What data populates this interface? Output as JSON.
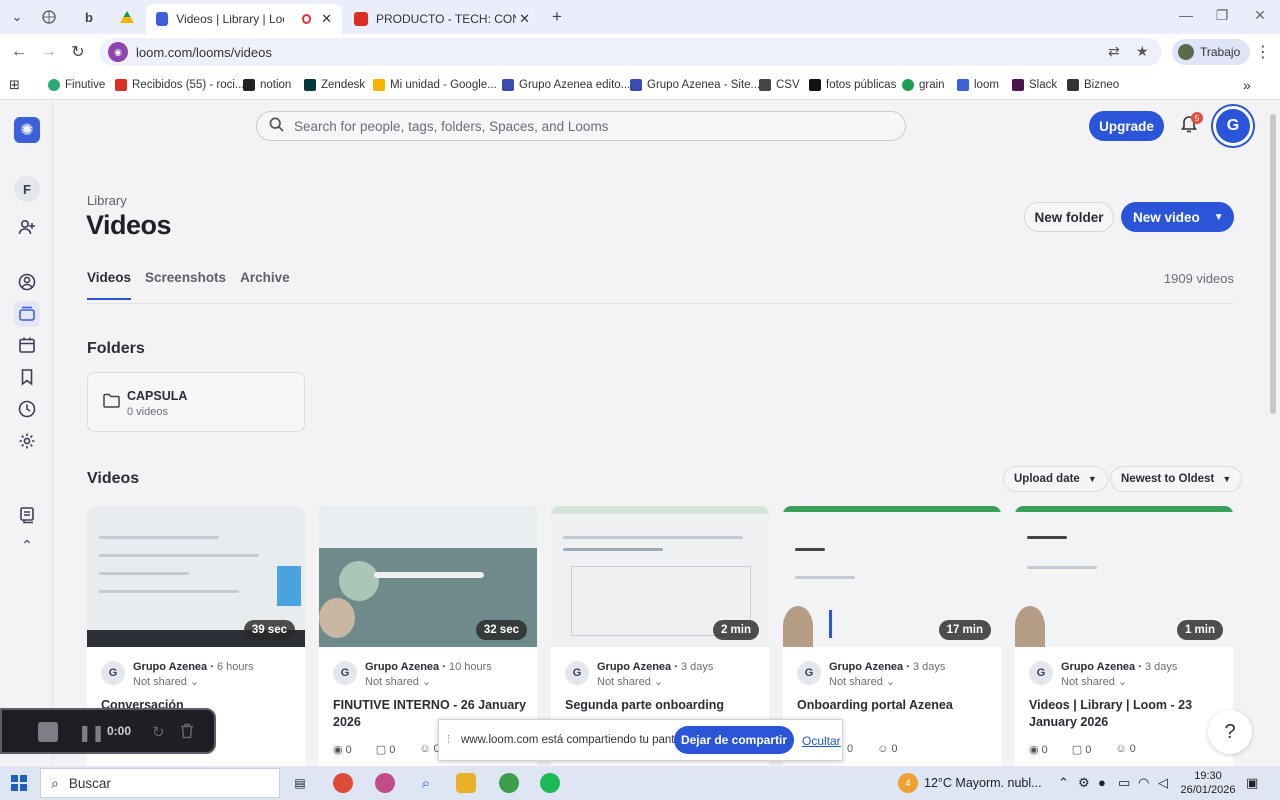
{
  "browser": {
    "tabs": [
      {
        "title": "Videos | Library | Loom",
        "active": true
      },
      {
        "title": "PRODUCTO - TECH: CONTABLE",
        "active": false
      }
    ],
    "new_tab": "+",
    "url": "loom.com/looms/videos",
    "profile_label": "Trabajo",
    "bookmarks": [
      "Finutive",
      "Recibidos (55) - roci...",
      "notion",
      "Zendesk",
      "Mi unidad - Google...",
      "Grupo Azenea edito...",
      "Grupo Azenea - Site...",
      "CSV",
      "fotos públicas",
      "grain",
      "loom",
      "Slack",
      "Bizneo"
    ],
    "bookmarks_more": "»"
  },
  "sidebar": {
    "workspace_initial": "F",
    "icons": [
      "invite-icon",
      "profile-icon",
      "library-icon",
      "calendar-icon",
      "bookmark-icon",
      "history-icon",
      "settings-icon",
      "notes-icon"
    ]
  },
  "header": {
    "search_placeholder": "Search for people, tags, folders, Spaces, and Looms",
    "upgrade_label": "Upgrade",
    "notification_count": "5",
    "user_initial": "G"
  },
  "library": {
    "breadcrumb": "Library",
    "title": "Videos",
    "new_folder_label": "New folder",
    "new_video_label": "New video",
    "tabs": [
      "Videos",
      "Screenshots",
      "Archive"
    ],
    "video_count": "1909 videos",
    "folders_heading": "Folders",
    "folder": {
      "name": "CAPSULA",
      "count": "0 videos"
    },
    "videos_heading": "Videos",
    "sort_by": "Upload date",
    "sort_order": "Newest to Oldest"
  },
  "videos": [
    {
      "duration": "39 sec",
      "owner": "Grupo Azenea",
      "ago": "6 hours",
      "share": "Not shared",
      "title": "Conversación",
      "views": "0",
      "comments": "0",
      "reactions": "0"
    },
    {
      "duration": "32 sec",
      "owner": "Grupo Azenea",
      "ago": "10 hours",
      "share": "Not shared",
      "title": "FINUTIVE INTERNO - 26 January 2026",
      "views": "0",
      "comments": "0",
      "reactions": "0"
    },
    {
      "duration": "2 min",
      "owner": "Grupo Azenea",
      "ago": "3 days",
      "share": "Not shared",
      "title": "Segunda parte onboarding",
      "views": "0",
      "comments": "0",
      "reactions": "0"
    },
    {
      "duration": "17 min",
      "owner": "Grupo Azenea",
      "ago": "3 days",
      "share": "Not shared",
      "title": "Onboarding portal Azenea",
      "views": "0",
      "comments": "0",
      "reactions": "0"
    },
    {
      "duration": "1 min",
      "owner": "Grupo Azenea",
      "ago": "3 days",
      "share": "Not shared",
      "title": "Videos | Library | Loom - 23 January 2026",
      "views": "0",
      "comments": "0",
      "reactions": "0"
    }
  ],
  "recorder": {
    "time": "0:00"
  },
  "sharebar": {
    "message": "www.loom.com está compartiendo tu pantalla.",
    "stop_label": "Dejar de compartir",
    "hide_label": "Ocultar"
  },
  "taskbar": {
    "search_label": "Buscar",
    "weather": "12°C  Mayorm. nubl...",
    "time": "19:30",
    "date": "26/01/2026",
    "weather_badge": "4"
  },
  "colors": {
    "accent": "#2b55d8",
    "loom_logo": "#3d5fd9",
    "badge": "#e0503e"
  }
}
